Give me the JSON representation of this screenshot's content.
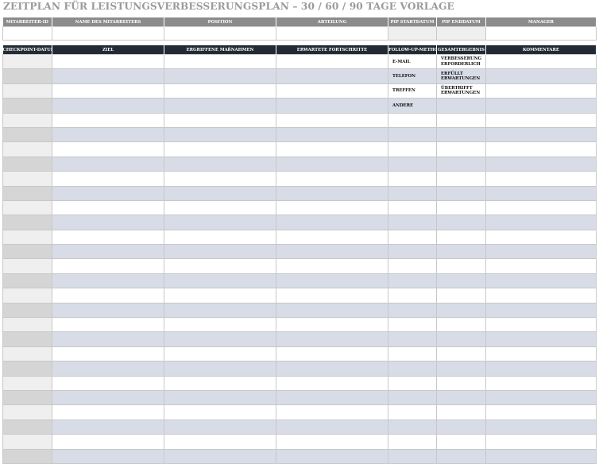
{
  "title": "ZEITPLAN FÜR LEISTUNGSVERBESSERUNGSPLAN – 30 / 60 / 90 TAGE VORLAGE",
  "employee_table": {
    "headers": [
      "MITARBEITER-ID",
      "NAME DES MITARBEITERS",
      "POSITION",
      "ABTEILUNG",
      "PIP STARTDATUM",
      "PIP ENDDATUM",
      "MANAGER"
    ]
  },
  "plan_table": {
    "headers": [
      "CHECKPOINT-DATUM",
      "ZIEL",
      "ERGRIFFENE MAßNAHMEN",
      "ERWARTETE FORTSCHRITTE",
      "FOLLOW-UP-METHODE",
      "GESAMTERGEBNIS",
      "KOMMENTARE"
    ],
    "follow_up_options": [
      "E-MAIL",
      "TELEFON",
      "TREFFEN",
      "ANDERE"
    ],
    "result_options": [
      "VERBESSERUNG ERFORDERLICH",
      "ERFÜLLT ERWARTUNGEN",
      "ÜBERTRIFFT ERWARTUNGEN"
    ]
  }
}
